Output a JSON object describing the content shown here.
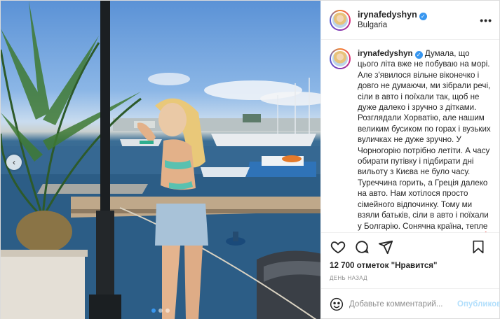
{
  "post": {
    "username": "irynafedyshyn",
    "verified_mark": "✓",
    "location": "Bulgaria",
    "more_glyph": "•••",
    "caption_text": "Думала, що цього літа вже не побуваю на морі. Але з'явилося вільне віконечко і довго не думаючи, ми зібрали речі, сіли в авто і поїхали так, щоб не дуже далеко і зручно з дітками. Розглядали Хорватію, але нашим великим бусиком по горах і вузьких вуличках не дуже зручно. У Чорногорію потрібно летіти. А часу обирати путівку і підбирати дні вильоту з Києва не було часу. Туреччина горить, а Греція далеко на авто. Нам хотілося просто сімейного відпочинку. Тому ми взяли батьків, сіли в авто і поїхали у Болгарію. Сонячна країна, тепле море, смачна їжа, приємні ціни 🥰 Заряджаємося позитивними емоціями та кайфуємо від часу",
    "likes": "12 700 отметок \"Нравится\"",
    "timestamp": "ДЕНЬ НАЗАД"
  },
  "photo": {
    "carousel_prev_glyph": "‹",
    "dots": 3,
    "active_dot": 0
  },
  "icons": {
    "like": "heart-icon",
    "comment": "comment-icon",
    "share": "share-icon",
    "save": "bookmark-icon",
    "emoji": "emoji-icon",
    "more": "more-icon"
  },
  "comment_box": {
    "placeholder": "Добавьте комментарий...",
    "publish_label": "Опубликовать"
  },
  "colors": {
    "accent": "#3897f0",
    "publish_disabled": "#b2dffc",
    "muted": "#8e8e8e"
  }
}
